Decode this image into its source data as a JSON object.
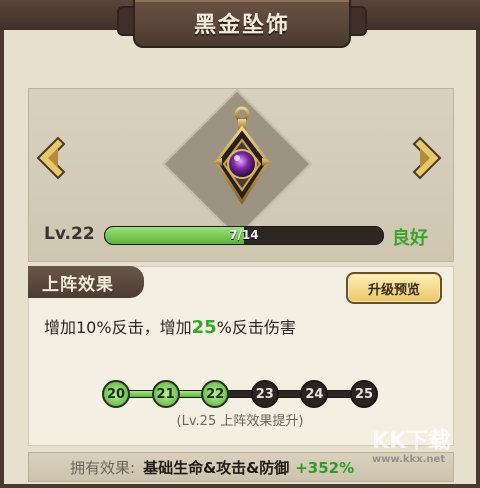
{
  "title": "黑金坠饰",
  "item": {
    "level_label": "Lv.22",
    "exp_text": "7/14",
    "exp_progress": 0.5,
    "quality": "良好",
    "icons": {
      "left": "chevron-left-icon",
      "right": "chevron-right-icon",
      "pendant": "pendant-icon"
    }
  },
  "effect": {
    "tab_label": "上阵效果",
    "preview_button": "升级预览",
    "desc_prefix": "增加10%反击，增加",
    "desc_highlight": "25",
    "desc_suffix": "%反击伤害",
    "levels": [
      "20",
      "21",
      "22",
      "23",
      "24",
      "25"
    ],
    "active_count": 3,
    "unlock_note": "(Lv.25 上阵效果提升)"
  },
  "owned": {
    "key": "拥有效果:",
    "value": "基础生命&攻击&防御",
    "bonus": "+352%"
  },
  "watermark": {
    "main": "KK下载",
    "sub": "www.kkx.net"
  },
  "colors": {
    "accent_green": "#3ca42c",
    "frame_brown": "#4a3a30",
    "gold": "#e9c66a"
  }
}
